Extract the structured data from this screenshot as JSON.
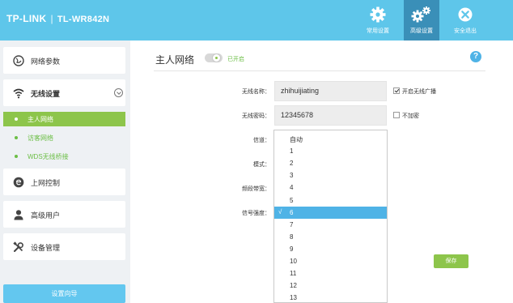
{
  "header": {
    "brand": "TP-LINK",
    "separator": "|",
    "model": "TL-WR842N",
    "nav": [
      {
        "label": "常用设置",
        "icon": "gear-icon",
        "active": false
      },
      {
        "label": "高级设置",
        "icon": "gears-icon",
        "active": true
      },
      {
        "label": "安全退出",
        "icon": "close-icon",
        "active": false
      }
    ]
  },
  "sidebar": {
    "items": [
      {
        "label": "网络参数",
        "icon": "globe-icon"
      },
      {
        "label": "无线设置",
        "icon": "wifi-icon"
      },
      {
        "label": "上网控制",
        "icon": "parental-control-icon"
      },
      {
        "label": "高级用户",
        "icon": "user-icon"
      },
      {
        "label": "设备管理",
        "icon": "tools-icon"
      }
    ],
    "wireless_sub": [
      {
        "label": "主人网络",
        "active": true
      },
      {
        "label": "访客网络",
        "active": false
      },
      {
        "label": "WDS无线桥接",
        "active": false
      }
    ],
    "wizard_label": "设置向导"
  },
  "main": {
    "title": "主人网络",
    "status": "已开启",
    "help": "?",
    "fields": {
      "ssid_label": "无线名称：",
      "ssid_value": "zhihuijiating",
      "broadcast_label": "开启无线广播",
      "broadcast_checked": true,
      "password_label": "无线密码：",
      "password_value": "12345678",
      "noencrypt_label": "不加密",
      "noencrypt_checked": false,
      "channel_label": "信道：",
      "mode_label": "模式：",
      "bandwidth_label": "频段带宽：",
      "signal_label": "信号强度："
    },
    "save_label": "保存"
  },
  "dropdown": {
    "options": [
      "自动",
      "1",
      "2",
      "3",
      "4",
      "5",
      "6",
      "7",
      "8",
      "9",
      "10",
      "11",
      "12",
      "13"
    ],
    "selected": "6",
    "check_mark": "√"
  },
  "colors": {
    "header": "#5ec6ea",
    "header_active": "#3a8fb8",
    "accent_green": "#8dc54b",
    "accent_blue": "#4fb3e6"
  }
}
